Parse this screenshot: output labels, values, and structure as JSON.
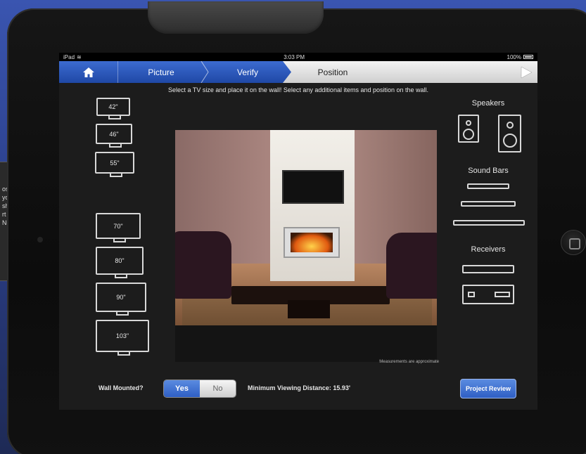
{
  "background_text": [
    "os",
    "yo",
    "sh",
    "rt",
    "Ne"
  ],
  "status_bar": {
    "device": "iPad",
    "time": "3:03 PM",
    "battery": "100%"
  },
  "nav": {
    "steps": [
      "Picture",
      "Verify",
      "Position"
    ]
  },
  "instructions": "Select a TV size and place it on the wall! Select any additional items and position on the wall.",
  "tv_sizes": [
    "42\"",
    "46\"",
    "55\"",
    "70\"",
    "80\"",
    "90\"",
    "103\""
  ],
  "sidebar": {
    "speakers_title": "Speakers",
    "soundbars_title": "Sound Bars",
    "receivers_title": "Receivers"
  },
  "room": {
    "note": "Measurements are approximate"
  },
  "footer": {
    "wall_mounted_label": "Wall Mounted?",
    "yes": "Yes",
    "no": "No",
    "selected": "Yes",
    "min_distance": "Minimum Viewing Distance: 15.93'",
    "project_review": "Project Review"
  },
  "colors": {
    "accent": "#2f5fc4",
    "nav_blue": "#1f48a6"
  }
}
